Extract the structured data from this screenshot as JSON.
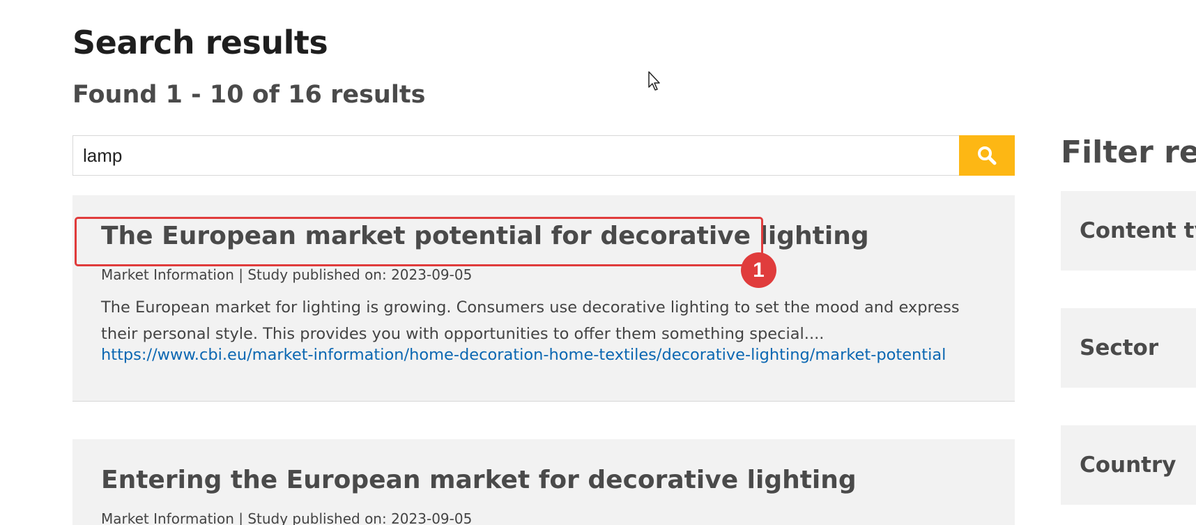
{
  "header": {
    "title": "Search results",
    "result_count": "Found 1 - 10 of 16 results"
  },
  "search": {
    "value": "lamp",
    "button_icon": "search-icon",
    "accent": "#fdb714"
  },
  "results": [
    {
      "title": "The European market potential for decorative lighting",
      "meta": "Market Information | Study published on: 2023-09-05",
      "description": "The European market for lighting is growing. Consumers use decorative lighting to set the mood and express their personal style. This provides you with opportunities to offer them something special....",
      "url": "https://www.cbi.eu/market-information/home-decoration-home-textiles/decorative-lighting/market-potential"
    },
    {
      "title": "Entering the European market for decorative lighting",
      "meta": "Market Information | Study published on: 2023-09-05"
    }
  ],
  "annotation": {
    "marker_label": "1",
    "color": "#e03c3c"
  },
  "filters": {
    "title": "Filter results",
    "groups": [
      "Content type",
      "Sector",
      "Country"
    ]
  },
  "colors": {
    "link": "#0b67b2",
    "card_bg": "#f2f2f2"
  }
}
